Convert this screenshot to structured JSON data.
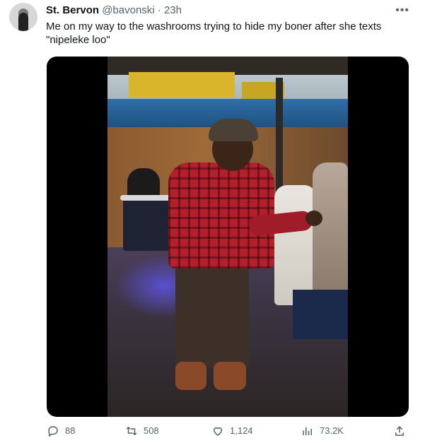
{
  "tweet": {
    "display_name": "St. Bervon",
    "handle": "@bavonski",
    "separator": "·",
    "time": "23h",
    "more_icon": "more-horizontal-icon",
    "text": "Me on my way to the washrooms trying to hide my boner after she texts \"nipeleke loo\""
  },
  "media": {
    "kind": "video-still"
  },
  "actions": {
    "reply": {
      "icon": "reply-icon",
      "count": "88"
    },
    "retweet": {
      "icon": "retweet-icon",
      "count": "508"
    },
    "like": {
      "icon": "heart-icon",
      "count": "1,124"
    },
    "views": {
      "icon": "views-icon",
      "count": "73.2K"
    },
    "share": {
      "icon": "share-icon"
    }
  }
}
